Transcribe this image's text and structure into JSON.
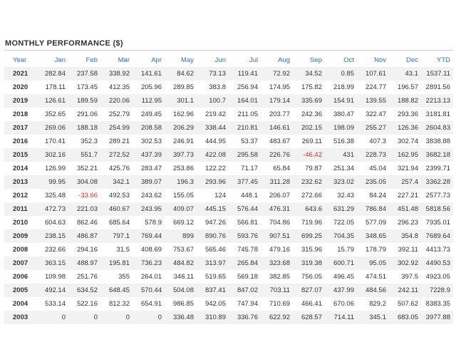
{
  "title": "MONTHLY PERFORMANCE ($)",
  "columns": [
    "Year",
    "Jan",
    "Feb",
    "Mar",
    "Apr",
    "May",
    "Jun",
    "Jul",
    "Aug",
    "Sep",
    "Oct",
    "Nov",
    "Dec",
    "YTD"
  ],
  "rows": [
    {
      "year": "2021",
      "values": [
        "282.84",
        "237.58",
        "338.92",
        "141.61",
        "84.62",
        "73.13",
        "119.41",
        "72.92",
        "34.52",
        "0.85",
        "107.61",
        "43.1",
        "1537.11"
      ]
    },
    {
      "year": "2020",
      "values": [
        "178.11",
        "173.45",
        "412.35",
        "205.96",
        "289.85",
        "383.8",
        "256.94",
        "174.95",
        "175.82",
        "218.99",
        "224.77",
        "196.57",
        "2891.56"
      ]
    },
    {
      "year": "2019",
      "values": [
        "126.61",
        "189.59",
        "220.06",
        "112.95",
        "301.1",
        "100.7",
        "164.01",
        "179.14",
        "335.69",
        "154.91",
        "139.55",
        "188.82",
        "2213.13"
      ]
    },
    {
      "year": "2018",
      "values": [
        "352.65",
        "291.06",
        "252.79",
        "249.45",
        "162.96",
        "219.42",
        "211.05",
        "203.77",
        "242.36",
        "380.47",
        "322.47",
        "293.36",
        "3181.81"
      ]
    },
    {
      "year": "2017",
      "values": [
        "269.06",
        "188.18",
        "254.99",
        "208.58",
        "206.29",
        "338.44",
        "210.81",
        "146.61",
        "202.15",
        "198.09",
        "255.27",
        "126.36",
        "2604.83"
      ]
    },
    {
      "year": "2016",
      "values": [
        "170.41",
        "352.3",
        "289.21",
        "302.53",
        "246.91",
        "444.95",
        "53.37",
        "483.67",
        "269.11",
        "516.38",
        "407.3",
        "302.74",
        "3838.88"
      ]
    },
    {
      "year": "2015",
      "values": [
        "302.16",
        "551.7",
        "272.52",
        "437.39",
        "397.73",
        "422.08",
        "295.58",
        "226.76",
        "-46.42",
        "431",
        "228.73",
        "162.95",
        "3682.18"
      ]
    },
    {
      "year": "2014",
      "values": [
        "126.99",
        "352.21",
        "425.76",
        "283.47",
        "253.86",
        "122.22",
        "71.17",
        "65.84",
        "79.87",
        "251.34",
        "45.04",
        "321.94",
        "2399.71"
      ]
    },
    {
      "year": "2013",
      "values": [
        "99.95",
        "304.08",
        "342.1",
        "389.07",
        "196.3",
        "293.96",
        "377.45",
        "311.28",
        "232.62",
        "323.02",
        "235.05",
        "257.4",
        "3362.28"
      ]
    },
    {
      "year": "2012",
      "values": [
        "325.48",
        "-33.66",
        "492.53",
        "243.62",
        "155.05",
        "124",
        "448.1",
        "206.07",
        "272.66",
        "32.43",
        "84.24",
        "227.21",
        "2577.73"
      ]
    },
    {
      "year": "2011",
      "values": [
        "472.73",
        "221.03",
        "460.67",
        "243.95",
        "409.07",
        "445.15",
        "576.44",
        "476.31",
        "643.6",
        "631.29",
        "786.84",
        "451.48",
        "5818.56"
      ]
    },
    {
      "year": "2010",
      "values": [
        "604.63",
        "862.46",
        "685.64",
        "578.9",
        "669.12",
        "947.26",
        "566.81",
        "704.86",
        "719.96",
        "722.05",
        "577.09",
        "296.23",
        "7935.01"
      ]
    },
    {
      "year": "2009",
      "values": [
        "238.15",
        "486.87",
        "797.1",
        "769.44",
        "899",
        "890.76",
        "593.76",
        "907.51",
        "699.25",
        "704.35",
        "348.65",
        "354.8",
        "7689.64"
      ]
    },
    {
      "year": "2008",
      "values": [
        "232.66",
        "294.16",
        "31.5",
        "408.69",
        "753.67",
        "565.46",
        "745.78",
        "479.16",
        "315.96",
        "15.79",
        "178.79",
        "392.11",
        "4413.73"
      ]
    },
    {
      "year": "2007",
      "values": [
        "363.15",
        "488.97",
        "195.81",
        "736.23",
        "484.82",
        "313.97",
        "265.84",
        "323.68",
        "319.38",
        "600.71",
        "95.05",
        "302.92",
        "4490.53"
      ]
    },
    {
      "year": "2006",
      "values": [
        "109.98",
        "251.76",
        "355",
        "264.01",
        "346.11",
        "519.65",
        "569.18",
        "382.85",
        "756.05",
        "496.45",
        "474.51",
        "397.5",
        "4923.05"
      ]
    },
    {
      "year": "2005",
      "values": [
        "492.14",
        "634.52",
        "648.45",
        "570.44",
        "504.08",
        "837.41",
        "847.02",
        "703.11",
        "827.07",
        "437.99",
        "484.56",
        "242.11",
        "7228.9"
      ]
    },
    {
      "year": "2004",
      "values": [
        "533.14",
        "522.16",
        "812.32",
        "654.91",
        "986.85",
        "942.05",
        "747.94",
        "710.69",
        "466.41",
        "670.06",
        "829.2",
        "507.62",
        "8383.35"
      ]
    },
    {
      "year": "2003",
      "values": [
        "0",
        "0",
        "0",
        "0",
        "336.48",
        "310.89",
        "336.76",
        "622.92",
        "628.57",
        "714.11",
        "345.1",
        "683.05",
        "3977.88"
      ]
    }
  ],
  "colors": {
    "header": "#3a6fb5",
    "negative": "#e03030",
    "stripe": "#f2f2f2"
  }
}
